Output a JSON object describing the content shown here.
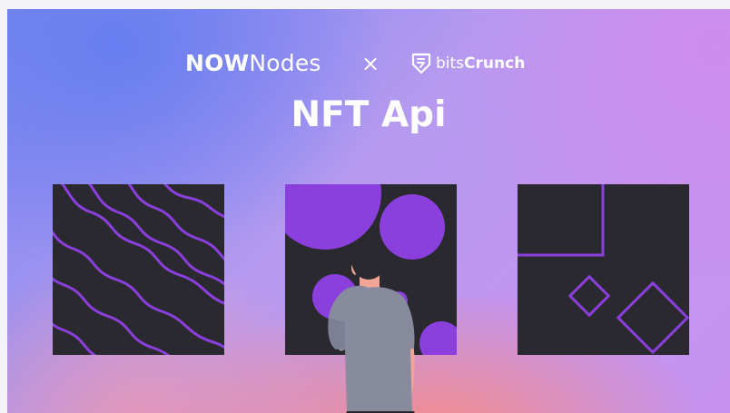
{
  "brand": {
    "nownodes_bold": "NOW",
    "nownodes_light": "Nodes",
    "times": "×",
    "bitscrunch_light": "bits",
    "bitscrunch_bold": "Crunch"
  },
  "title": "NFT Api",
  "colors": {
    "accent_purple": "#8b3fdc",
    "panel_dark": "#2a2930",
    "text_white": "#ffffff",
    "gradient_blue": "#6b80ee",
    "gradient_violet": "#c794ef",
    "gradient_coral": "#f6908a"
  },
  "icons": [
    "bitscrunch-logo-icon"
  ],
  "artworks": [
    "wavy-lines-artwork",
    "circles-artwork",
    "squares-artwork"
  ]
}
